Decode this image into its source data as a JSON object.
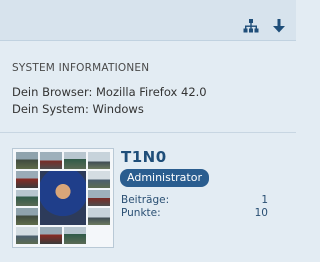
{
  "toolbar": {
    "icons": [
      "sitemap-icon",
      "arrow-down-icon"
    ]
  },
  "system_info": {
    "heading": "SYSTEM INFORMATIONEN",
    "browser": "Dein Browser: Mozilla Firefox 42.0",
    "system": "Dein System: Windows"
  },
  "user": {
    "name": "T1N0",
    "rank": "Administrator",
    "stats": [
      {
        "label": "Beiträge:",
        "value": "1"
      },
      {
        "label": "Punkte:",
        "value": "10"
      }
    ]
  }
}
